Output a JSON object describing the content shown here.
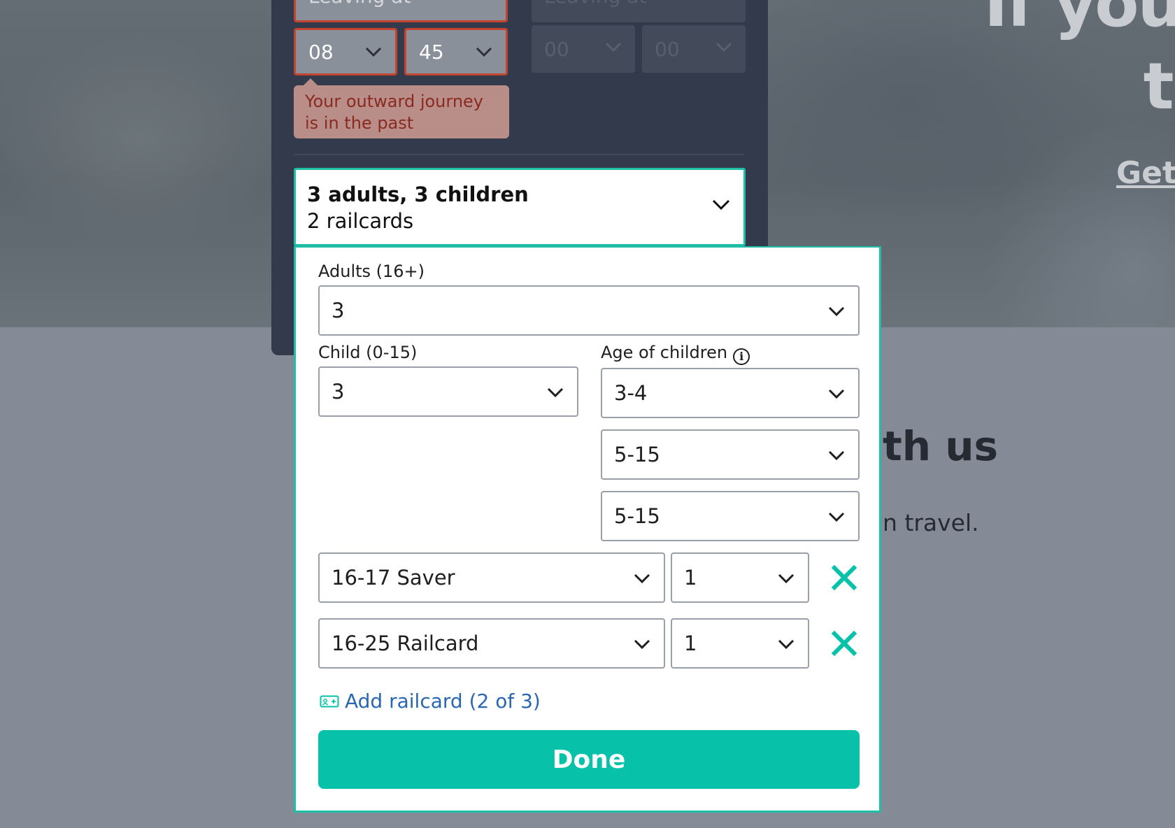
{
  "background": {
    "hero_line1": "If you",
    "hero_line2": "tr",
    "hero_link": "Get",
    "section_title": "th us",
    "section_subtitle": "n travel."
  },
  "journey": {
    "outward": {
      "leaving_label": "Leaving at",
      "hour": "08",
      "minute": "45",
      "error": "Your outward journey is in the past"
    },
    "return": {
      "leaving_label": "Leaving at",
      "hour": "00",
      "minute": "00"
    }
  },
  "passengers": {
    "summary_line1": "3 adults, 3 children",
    "summary_line2": "2 railcards",
    "adults_label": "Adults (16+)",
    "adults_value": "3",
    "child_label": "Child (0-15)",
    "child_value": "3",
    "age_label": "Age of children",
    "child_ages": [
      "3-4",
      "5-15",
      "5-15"
    ],
    "railcards": [
      {
        "type": "16-17 Saver",
        "count": "1"
      },
      {
        "type": "16-25 Railcard",
        "count": "1"
      }
    ],
    "add_railcard_label": "Add railcard (2 of 3)",
    "done_label": "Done"
  },
  "colors": {
    "accent": "#07c2a8",
    "error": "#c2442f",
    "link": "#2b66b0",
    "panel": "#323a4b"
  },
  "icons": {
    "chevron": "chevron-down-icon",
    "remove": "close-icon",
    "info": "info-icon",
    "railcard": "railcard-icon"
  }
}
